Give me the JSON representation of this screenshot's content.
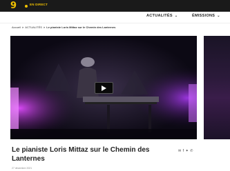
{
  "header": {
    "logo": "9",
    "live_label": "EN DIRECT"
  },
  "nav": {
    "items": [
      {
        "label": "ACTUALITÉS",
        "chevron": "⌄"
      },
      {
        "label": "ÉMISSIONS",
        "chevron": "⌄"
      }
    ]
  },
  "breadcrumb": {
    "home": "Accueil",
    "section": "ACTUALITÉS",
    "current": "Le pianiste Loris Mittaz sur le Chemin des Lanternes",
    "separator": ">"
  },
  "article": {
    "title": "Le pianiste Loris Mittaz sur le Chemin des Lanternes",
    "date": "27 décembre 2021"
  },
  "share": {
    "icons": [
      "mail-icon",
      "facebook-icon",
      "twitter-icon",
      "whatsapp-icon"
    ],
    "glyphs": [
      "✉",
      "f",
      "✦",
      "✆"
    ]
  },
  "colors": {
    "accent": "#f2c200",
    "topbar": "#1a1a1a",
    "video_glow": "#c43cff"
  }
}
